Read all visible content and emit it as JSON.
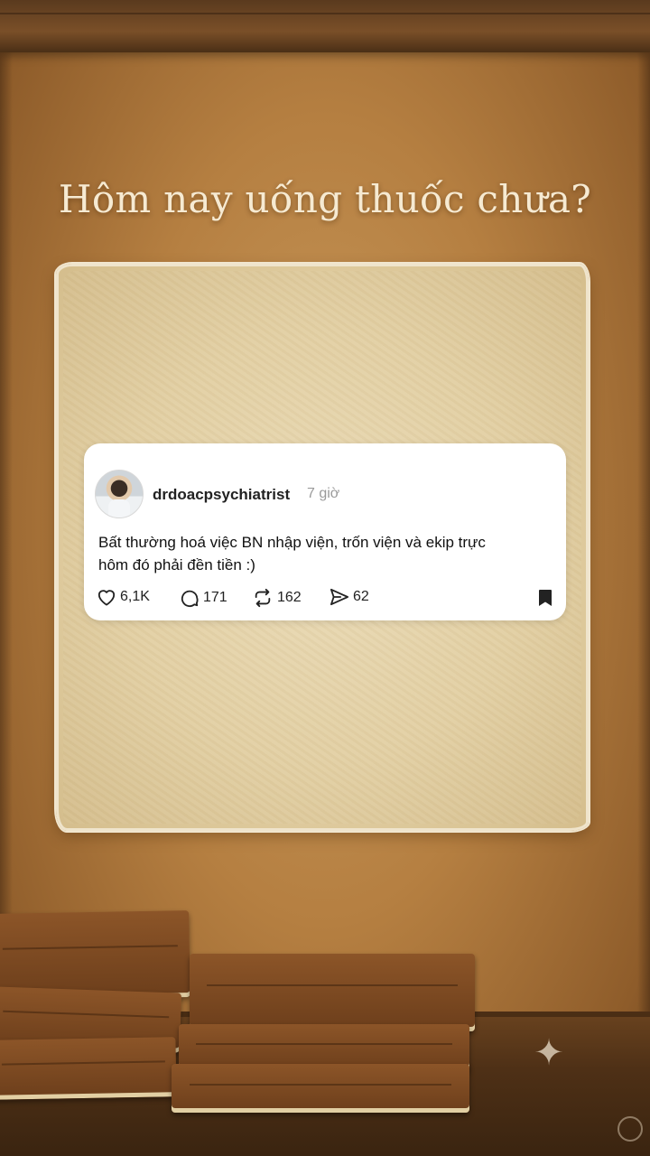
{
  "headline": "Hôm nay uống thuốc chưa?",
  "post": {
    "username": "drdoacpsychiatrist",
    "timestamp": "7 giờ",
    "text_line1": "Bất thường hoá việc BN nhập viện, trốn viện và ekip trực",
    "text_line2": "hôm đó phải đền tiền :)",
    "likes": "6,1K",
    "replies": "171",
    "reposts": "162",
    "shares": "62"
  },
  "icons": {
    "like": "heart-icon",
    "reply": "comment-icon",
    "repost": "repost-icon",
    "share": "send-icon",
    "bookmark": "bookmark-icon",
    "sparkle": "sparkle-icon"
  },
  "colors": {
    "background": "#b57f41",
    "paper": "#e2cfa3",
    "card": "#ffffff",
    "headline": "#f6ead2"
  }
}
